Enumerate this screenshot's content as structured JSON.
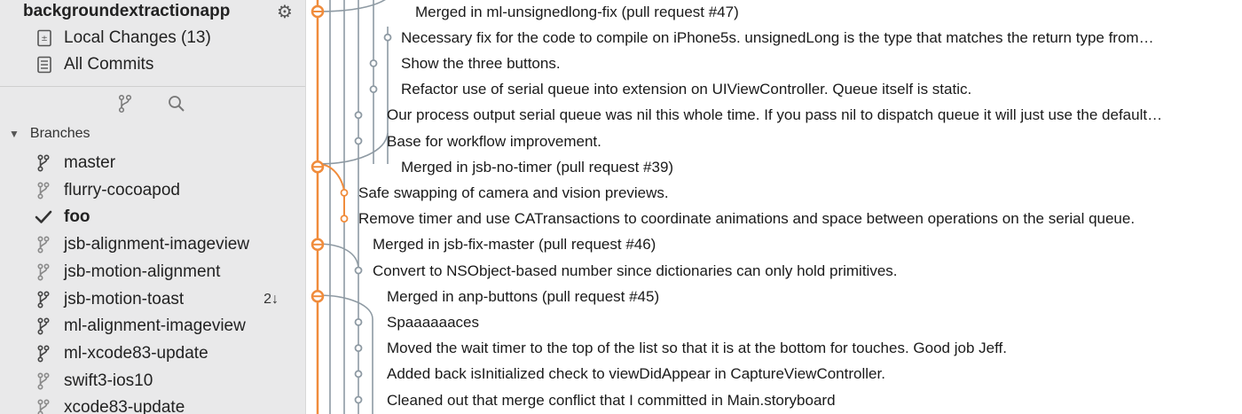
{
  "sidebar": {
    "repo_name": "backgroundextractionapp",
    "nav": [
      {
        "label": "Local Changes (13)",
        "icon": "local-changes-icon"
      },
      {
        "label": "All Commits",
        "icon": "all-commits-icon"
      }
    ],
    "toolbar": {
      "branch_icon": "branch-filter-icon",
      "search_icon": "search-icon"
    },
    "branches_section": "Branches",
    "branches": [
      {
        "label": "master",
        "current": false,
        "badge": ""
      },
      {
        "label": "flurry-cocoapod",
        "current": false,
        "badge": ""
      },
      {
        "label": "foo",
        "current": true,
        "badge": ""
      },
      {
        "label": "jsb-alignment-imageview",
        "current": false,
        "badge": ""
      },
      {
        "label": "jsb-motion-alignment",
        "current": false,
        "badge": ""
      },
      {
        "label": "jsb-motion-toast",
        "current": false,
        "badge": "2↓"
      },
      {
        "label": "ml-alignment-imageview",
        "current": false,
        "badge": ""
      },
      {
        "label": "ml-xcode83-update",
        "current": false,
        "badge": ""
      },
      {
        "label": "swift3-ios10",
        "current": false,
        "badge": ""
      },
      {
        "label": "xcode83-update",
        "current": false,
        "badge": ""
      }
    ]
  },
  "colors": {
    "accent": "#f08c3c",
    "graph_gray": "#8e9aa3"
  },
  "commits": [
    {
      "message": "Merged in ml-unsignedlong-fix (pull request #47)",
      "merge": true
    },
    {
      "message": "Necessary fix for the code to compile on iPhone5s. unsignedLong is the type that matches the return type from…",
      "merge": false
    },
    {
      "message": "Show the three buttons.",
      "merge": false
    },
    {
      "message": "Refactor use of serial queue into extension on UIViewController. Queue itself is static.",
      "merge": false
    },
    {
      "message": "Our process output serial queue was nil this whole time. If you pass nil to dispatch queue it will just use the default…",
      "merge": false
    },
    {
      "message": "Base for workflow improvement.",
      "merge": false
    },
    {
      "message": "Merged in jsb-no-timer (pull request #39)",
      "merge": true
    },
    {
      "message": "Safe swapping of camera and vision previews.",
      "merge": false
    },
    {
      "message": "Remove timer and use CATransactions to coordinate animations and space between operations on the serial queue.",
      "merge": false
    },
    {
      "message": "Merged in jsb-fix-master (pull request #46)",
      "merge": true
    },
    {
      "message": "Convert to NSObject-based number since dictionaries can only hold primitives.",
      "merge": false
    },
    {
      "message": "Merged in anp-buttons (pull request #45)",
      "merge": true
    },
    {
      "message": "Spaaaaaaces",
      "merge": false
    },
    {
      "message": "Moved the wait timer to the top of the list so that it is at the bottom for touches. Good job Jeff.",
      "merge": false
    },
    {
      "message": "Added back isInitialized check to viewDidAppear in CaptureViewController.",
      "merge": false
    },
    {
      "message": "Cleaned out that merge conflict that I committed in Main.storyboard",
      "merge": false
    }
  ]
}
